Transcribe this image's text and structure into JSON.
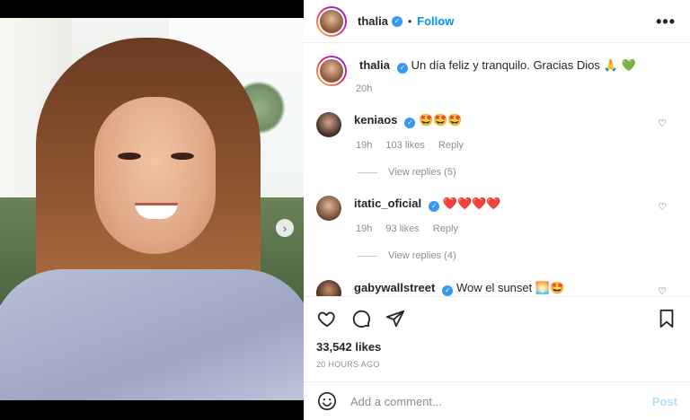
{
  "post": {
    "username": "thalia",
    "follow_label": "Follow",
    "more_label": "•••",
    "separator": "•"
  },
  "caption": {
    "username": "thalia",
    "text": "Un día feliz y tranquilo. Gracias Dios",
    "emoji": "🙏 💚",
    "time": "20h"
  },
  "comments": [
    {
      "username": "keniaos",
      "text": "🤩🤩🤩",
      "time": "19h",
      "likes": "103 likes",
      "reply_label": "Reply",
      "view_replies": "View replies (5)"
    },
    {
      "username": "itatic_oficial",
      "text": "❤️❤️❤️❤️",
      "time": "19h",
      "likes": "93 likes",
      "reply_label": "Reply",
      "view_replies": "View replies (4)"
    },
    {
      "username": "gabywallstreet",
      "text": "Wow el sunset",
      "emoji": "🌅🤩"
    }
  ],
  "actions": {
    "likes": "33,542 likes",
    "timestamp": "20 HOURS AGO"
  },
  "composer": {
    "placeholder": "Add a comment...",
    "post_label": "Post"
  },
  "media": {
    "carousel_dots": 3,
    "active_dot": 0
  },
  "colors": {
    "link_blue": "#0095f6",
    "verified_blue": "#3897f0",
    "post_disabled": "#b2dffc",
    "muted": "#8e8e8e"
  },
  "icons": [
    "heart-icon",
    "comment-icon",
    "share-icon",
    "bookmark-icon",
    "emoji-icon",
    "chevron-right-icon",
    "more-icon"
  ]
}
